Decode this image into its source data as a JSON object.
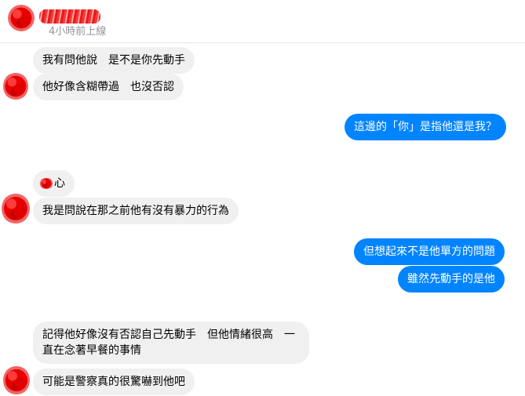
{
  "header": {
    "status": "4小時前上線"
  },
  "messages": {
    "m1": "我有問他說　是不是你先動手",
    "m2": "他好像含糊帶過　也沒否認",
    "m3": "這邊的「你」是指他還是我？",
    "m4": "心",
    "m5": "我是問說在那之前他有沒有暴力的行為",
    "m6": "但想起來不是他單方的問題",
    "m7": "雖然先動手的是他",
    "m8": "記得他好像沒有否認自己先動手　但他情緒很高　一直在念著早餐的事情",
    "m9": "可能是警察真的很驚嚇到他吧"
  },
  "colors": {
    "incoming_bubble": "#f1f0f0",
    "outgoing_bubble": "#0084ff",
    "status_text": "#90949c"
  }
}
